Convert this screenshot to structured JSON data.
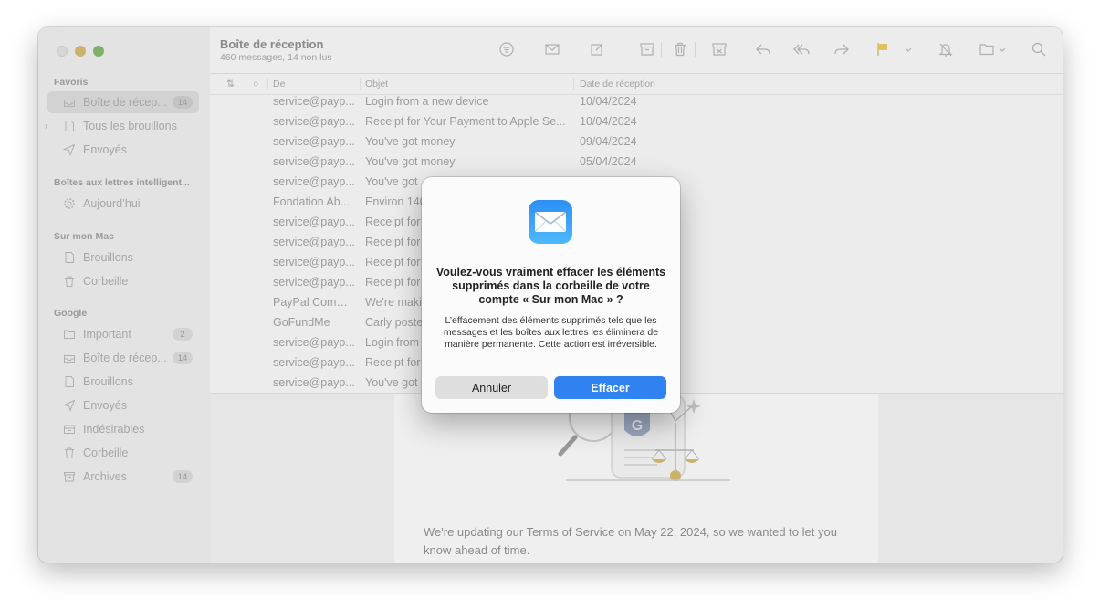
{
  "mailbox": {
    "title": "Boîte de réception",
    "subtitle": "460 messages, 14 non lus"
  },
  "sidebar": {
    "sections": [
      {
        "label": "Favoris",
        "items": [
          {
            "label": "Boîte de récep...",
            "icon": "inbox-icon",
            "badge": "14",
            "selected": true
          },
          {
            "label": "Tous les brouillons",
            "icon": "draft-icon",
            "chevron": "›"
          },
          {
            "label": "Envoyés",
            "icon": "sent-icon"
          }
        ]
      },
      {
        "label": "Boîtes aux lettres intelligent...",
        "items": [
          {
            "label": "Aujourd’hui",
            "icon": "gear-icon"
          }
        ]
      },
      {
        "label": "Sur mon Mac",
        "items": [
          {
            "label": "Brouillons",
            "icon": "draft-icon"
          },
          {
            "label": "Corbeille",
            "icon": "trash-icon"
          }
        ]
      },
      {
        "label": "Google",
        "items": [
          {
            "label": "Important",
            "icon": "folder-icon",
            "badge": "2"
          },
          {
            "label": "Boîte de récep...",
            "icon": "inbox-icon",
            "badge": "14"
          },
          {
            "label": "Brouillons",
            "icon": "draft-icon"
          },
          {
            "label": "Envoyés",
            "icon": "sent-icon"
          },
          {
            "label": "Indésirables",
            "icon": "junk-icon"
          },
          {
            "label": "Corbeille",
            "icon": "trash-icon"
          },
          {
            "label": "Archives",
            "icon": "archive-icon",
            "badge": "14"
          }
        ]
      }
    ]
  },
  "table": {
    "headers": {
      "sort": "⇅",
      "status": "○",
      "from": "De",
      "subject": "Objet",
      "date": "Date de réception"
    },
    "rows": [
      {
        "from": "service@payp...",
        "subject": "Login from a new device",
        "date": "10/04/2024"
      },
      {
        "from": "service@payp...",
        "subject": "Receipt for Your Payment to Apple Se...",
        "date": "10/04/2024"
      },
      {
        "from": "service@payp...",
        "subject": "You've got money",
        "date": "09/04/2024"
      },
      {
        "from": "service@payp...",
        "subject": "You've got money",
        "date": "05/04/2024"
      },
      {
        "from": "service@payp...",
        "subject": "You've got",
        "date": ""
      },
      {
        "from": "Fondation Ab...",
        "subject": "Environ 140",
        "date": ""
      },
      {
        "from": "service@payp...",
        "subject": "Receipt for",
        "date": ""
      },
      {
        "from": "service@payp...",
        "subject": "Receipt for",
        "date": ""
      },
      {
        "from": "service@payp...",
        "subject": "Receipt for",
        "date": ""
      },
      {
        "from": "service@payp...",
        "subject": "Receipt for",
        "date": ""
      },
      {
        "from": "PayPal Comm...",
        "subject": "We're maki",
        "date": ""
      },
      {
        "from": "GoFundMe",
        "subject": "Carly poste",
        "date": ""
      },
      {
        "from": "service@payp...",
        "subject": "Login from",
        "date": ""
      },
      {
        "from": "service@payp...",
        "subject": "Receipt for",
        "date": ""
      },
      {
        "from": "service@payp...",
        "subject": "You've got",
        "date": ""
      }
    ]
  },
  "preview": {
    "text": "We're updating our Terms of Service on May 22, 2024, so we wanted to let you know ahead of time.",
    "logo_letter": "G"
  },
  "dialog": {
    "title": "Voulez-vous vraiment effacer les éléments supprimés dans la corbeille de votre compte « Sur mon Mac » ?",
    "body": "L’effacement des éléments supprimés tels que les messages et les boîtes aux lettres les éliminera de manière permanente. Cette action est irréversible.",
    "cancel_label": "Annuler",
    "confirm_label": "Effacer",
    "icon": "mail-app-icon"
  },
  "colors": {
    "accent": "#2f82f0",
    "flag": "#e0c060",
    "icon_gray": "#b0b0b0"
  }
}
